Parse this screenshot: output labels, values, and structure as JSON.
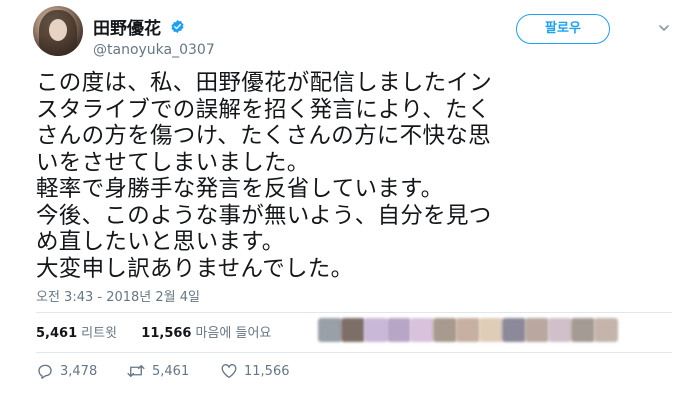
{
  "user": {
    "display_name": "田野優花",
    "handle": "@tanoyuka_0307",
    "verified": true
  },
  "follow_button": {
    "label": "팔로우",
    "color": "#1da1f2"
  },
  "tweet": {
    "lines": [
      "この度は、私、田野優花が配信しましたイン",
      "スタライブでの誤解を招く発言により、たく",
      "さんの方を傷つけ、たくさんの方に不快な思",
      "いをさせてしまいました。",
      "軽率で身勝手な発言を反省しています。",
      "今後、このような事が無いよう、自分を見つ",
      "め直したいと思います。",
      "大変申し訳ありませんでした。"
    ],
    "timestamp": "오전 3:43 - 2018년 2월 4일"
  },
  "stats": {
    "retweets_count": "5,461",
    "retweets_label": "리트윗",
    "likes_count": "11,566",
    "likes_label": "마음에 들어요"
  },
  "liker_avatar_colors": [
    "#9aa0a8",
    "#7d6f68",
    "#c9b8d8",
    "#b7a6c6",
    "#d8c2dc",
    "#a89a8e",
    "#c7b0a2",
    "#e0cdb8",
    "#8c8a9a",
    "#b9a7a0",
    "#d1c0c9",
    "#a39b94",
    "#c4b4ab"
  ],
  "actions": {
    "replies": "3,478",
    "retweets": "5,461",
    "likes": "11,566"
  },
  "colors": {
    "accent": "#1da1f2",
    "muted": "#657786",
    "text": "#14171a"
  }
}
